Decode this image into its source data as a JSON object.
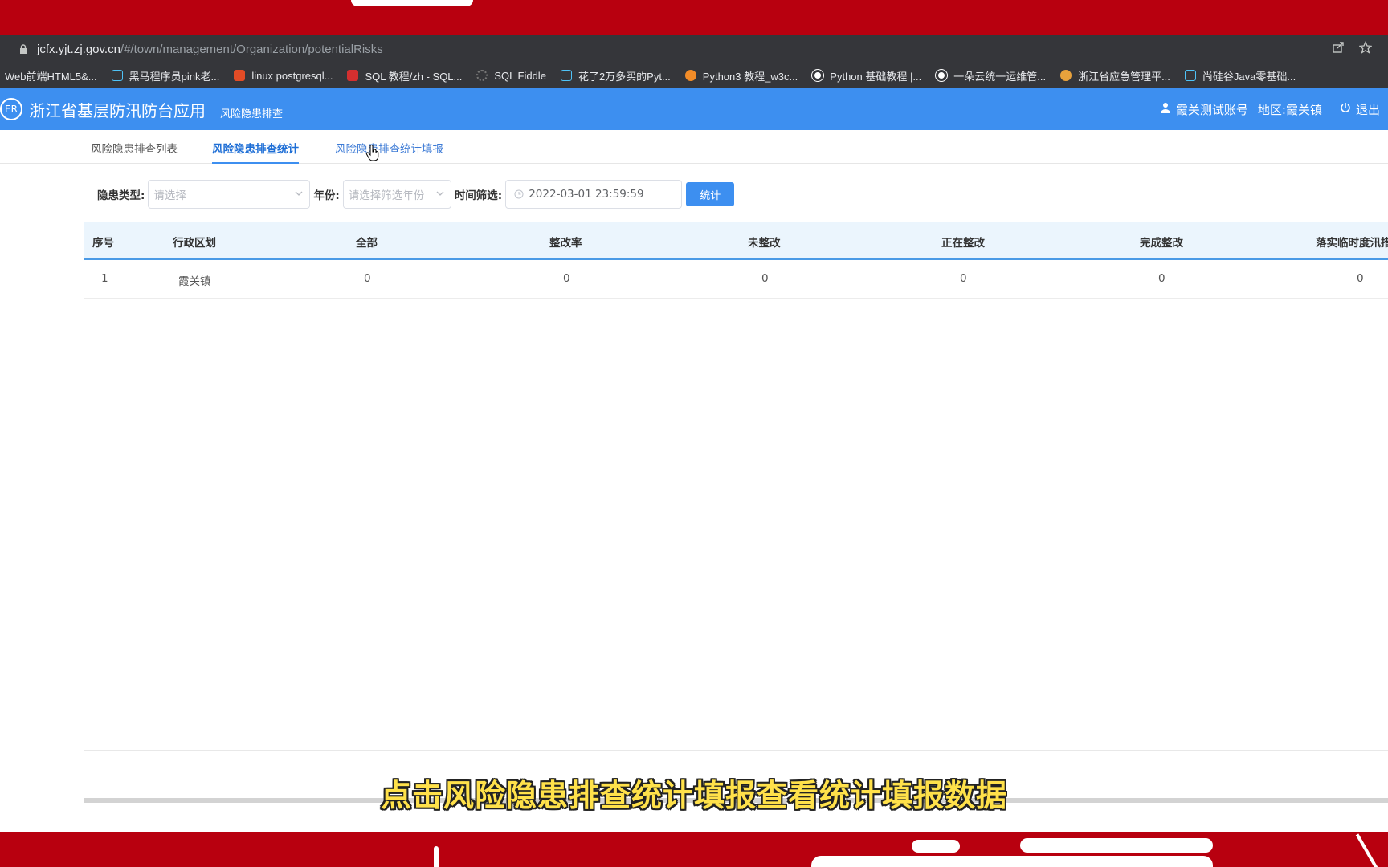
{
  "browser": {
    "url_host": "jcfx.yjt.zj.gov.cn",
    "url_path": "/#/town/management/Organization/potentialRisks",
    "bookmarks": [
      {
        "label": "Web前端HTML5&...",
        "icon": "none",
        "color": "#35363a"
      },
      {
        "label": "黑马程序员pink老...",
        "icon": "tv-icon",
        "color": "#4fc3f7"
      },
      {
        "label": "linux postgresql...",
        "icon": "c-icon",
        "color": "#e34c26"
      },
      {
        "label": "SQL 教程/zh - SQL...",
        "icon": "sql-icon",
        "color": "#d32f2f"
      },
      {
        "label": "SQL Fiddle",
        "icon": "gear-icon",
        "color": "#777"
      },
      {
        "label": "花了2万多买的Pyt...",
        "icon": "tv-icon",
        "color": "#4fc3f7"
      },
      {
        "label": "Python3 教程_w3c...",
        "icon": "flower-icon",
        "color": "#f28c28"
      },
      {
        "label": "Python 基础教程 |...",
        "icon": "globe-icon",
        "color": "#555"
      },
      {
        "label": "一朵云统一运维管...",
        "icon": "globe-icon",
        "color": "#555"
      },
      {
        "label": "浙江省应急管理平...",
        "icon": "circle-icon",
        "color": "#e8a23c"
      },
      {
        "label": "尚硅谷Java零基础...",
        "icon": "tv-icon",
        "color": "#4fc3f7"
      }
    ]
  },
  "header": {
    "logo_text": "ER",
    "title": "浙江省基层防汛防台应用",
    "subtitle": "风险隐患排查",
    "user": "霞关测试账号",
    "region": "地区:霞关镇",
    "logout": "退出",
    "color": "#3d8ff0"
  },
  "tabs": [
    {
      "label": "风险隐患排查列表",
      "state": "normal"
    },
    {
      "label": "风险隐患排查统计",
      "state": "active"
    },
    {
      "label": "风险隐患排查统计填报",
      "state": "hover"
    }
  ],
  "filters": {
    "type_label": "隐患类型:",
    "type_placeholder": "请选择",
    "year_label": "年份:",
    "year_placeholder": "请选择筛选年份",
    "time_label": "时间筛选:",
    "time_value": "2022-03-01 23:59:59",
    "stat_button": "统计"
  },
  "table": {
    "columns": [
      "序号",
      "行政区划",
      "全部",
      "整改率",
      "未整改",
      "正在整改",
      "完成整改",
      "落实临时度汛措"
    ],
    "rows": [
      [
        "1",
        "霞关镇",
        "0",
        "0",
        "0",
        "0",
        "0",
        "0"
      ]
    ]
  },
  "caption": "点击风险隐患排查统计填报查看统计填报数据"
}
